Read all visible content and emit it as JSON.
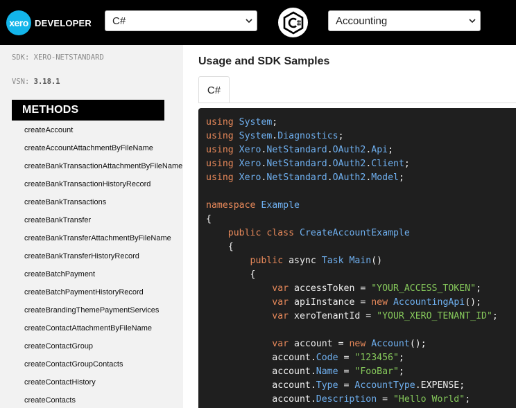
{
  "header": {
    "logo_mark": "xero",
    "logo_text": "DEVELOPER",
    "language_select": {
      "value": "C#"
    },
    "api_select": {
      "value": "Accounting"
    },
    "language_icon": "csharp-icon"
  },
  "sidebar": {
    "sdk_label": "SDK:",
    "sdk_value": "XERO-NETSTANDARD",
    "vsn_label": "VSN:",
    "vsn_value": "3.18.1",
    "methods_title": "METHODS",
    "methods": [
      "createAccount",
      "createAccountAttachmentByFileName",
      "createBankTransactionAttachmentByFileName",
      "createBankTransactionHistoryRecord",
      "createBankTransactions",
      "createBankTransfer",
      "createBankTransferAttachmentByFileName",
      "createBankTransferHistoryRecord",
      "createBatchPayment",
      "createBatchPaymentHistoryRecord",
      "createBrandingThemePaymentServices",
      "createContactAttachmentByFileName",
      "createContactGroup",
      "createContactGroupContacts",
      "createContactHistory",
      "createContacts"
    ]
  },
  "main": {
    "title": "Usage and SDK Samples",
    "tab_label": "C#",
    "code_lines": [
      "using System;",
      "using System.Diagnostics;",
      "using Xero.NetStandard.OAuth2.Api;",
      "using Xero.NetStandard.OAuth2.Client;",
      "using Xero.NetStandard.OAuth2.Model;",
      "",
      "namespace Example",
      "{",
      "    public class CreateAccountExample",
      "    {",
      "        public async Task Main()",
      "        {",
      "            var accessToken = \"YOUR_ACCESS_TOKEN\";",
      "            var apiInstance = new AccountingApi();",
      "            var xeroTenantId = \"YOUR_XERO_TENANT_ID\";",
      "",
      "            var account = new Account();",
      "            account.Code = \"123456\";",
      "            account.Name = \"FooBar\";",
      "            account.Type = AccountType.EXPENSE;",
      "            account.Description = \"Hello World\";"
    ]
  },
  "colors": {
    "keyword": "#e8895a",
    "type": "#6fb0f0",
    "string": "#86c95b",
    "brand": "#13b5ea"
  }
}
